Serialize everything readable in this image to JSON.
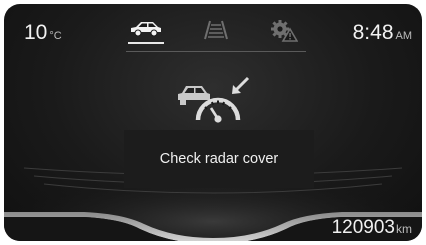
{
  "status_bar": {
    "temperature": "10",
    "temperature_unit": "°C",
    "time": "8:48",
    "time_period": "AM"
  },
  "tabs": [
    {
      "icon": "car-icon",
      "active": true
    },
    {
      "icon": "lane-icon",
      "active": false
    },
    {
      "icon": "vehicle-settings-warning-icon",
      "active": false
    }
  ],
  "warning": {
    "icon": "radar-sensor-warning-icon",
    "message": "Check radar cover"
  },
  "odometer": {
    "value": "120903",
    "unit": "km"
  },
  "colors": {
    "background": "#1a1a1a",
    "text": "#f0f0f0",
    "inactive_icon": "#6f6f6f"
  }
}
